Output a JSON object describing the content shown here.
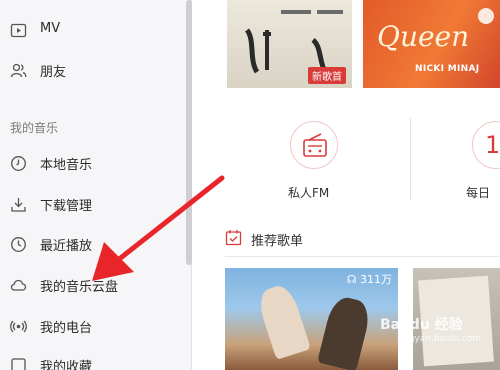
{
  "sidebar": {
    "top_items": [
      {
        "label": "MV",
        "icon": "video-icon"
      },
      {
        "label": "朋友",
        "icon": "friends-icon"
      }
    ],
    "section_title": "我的音乐",
    "my_music_items": [
      {
        "label": "本地音乐",
        "icon": "clock-icon"
      },
      {
        "label": "下载管理",
        "icon": "download-icon"
      },
      {
        "label": "最近播放",
        "icon": "history-icon"
      },
      {
        "label": "我的音乐云盘",
        "icon": "cloud-icon"
      },
      {
        "label": "我的电台",
        "icon": "radio-icon"
      },
      {
        "label": "我的收藏",
        "icon": "favorites-icon"
      }
    ]
  },
  "main": {
    "banner_left_tag": "新歌首",
    "banner_right": {
      "title": "Queen",
      "artist": "NICKI MINAJ"
    },
    "shortcuts": [
      {
        "label": "私人FM",
        "icon": "radio-fm-icon"
      },
      {
        "label": "每日",
        "icon": "daily-icon",
        "icon_text": "1"
      }
    ],
    "recommend_title": "推荐歌单",
    "playlist_count": "311万"
  },
  "watermark": {
    "text": "Bai du 经验",
    "sub": "jingyan.baidu.com"
  },
  "colors": {
    "accent": "#d93b39",
    "sidebar_bg": "#f6f6f8",
    "annotation_arrow": "#e8262a"
  }
}
